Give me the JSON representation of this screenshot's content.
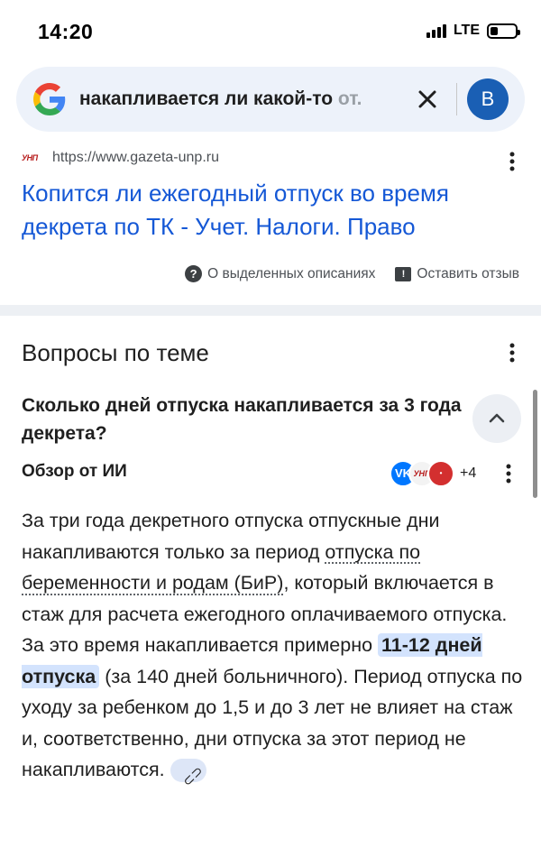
{
  "status_bar": {
    "time": "14:20",
    "network": "LTE",
    "battery_level": 0.3
  },
  "search": {
    "query": "накапливается ли какой-то от...",
    "query_visible": "накапливается ли какой-то",
    "query_faded": "от.",
    "avatar_letter": "В",
    "icons": [
      "google-logo",
      "close-icon"
    ]
  },
  "result": {
    "favicon_text": "УНП",
    "url": "https://www.gazeta-unp.ru",
    "title": "Копится ли ежегодный отпуск во время декрета по ТК - Учет. Налоги. Право",
    "about_snippets": "О выделенных описаниях",
    "leave_feedback": "Оставить отзыв"
  },
  "related": {
    "section_title": "Вопросы по теме",
    "question": "Сколько дней отпуска накапливается за 3 года декрета?",
    "ai_overview_label": "Обзор от ИИ",
    "sources": [
      {
        "name": "vk-icon",
        "label": "VK",
        "color": "#0077ff"
      },
      {
        "name": "unp-icon",
        "label": "УНП",
        "color": "#b71c1c"
      },
      {
        "name": "source-red-icon",
        "label": "•",
        "color": "#d32f2f"
      }
    ],
    "sources_more": "+4",
    "answer": {
      "part1": "За три года декретного отпуска отпускные дни накапливаются только за период ",
      "link_text": "отпуска по беременности и родам (БиР)",
      "part2": ", который включается в стаж для расчета ежегодного оплачиваемого отпуска. За это время накапливается примерно ",
      "highlight": "11-12 дней отпуска",
      "part3": " (за 140 дней больничного). Период отпуска по уходу за ребенком до 1,5 и до 3 лет не влияет на стаж и, соответственно, дни отпуска за этот период не накапливаются."
    }
  }
}
